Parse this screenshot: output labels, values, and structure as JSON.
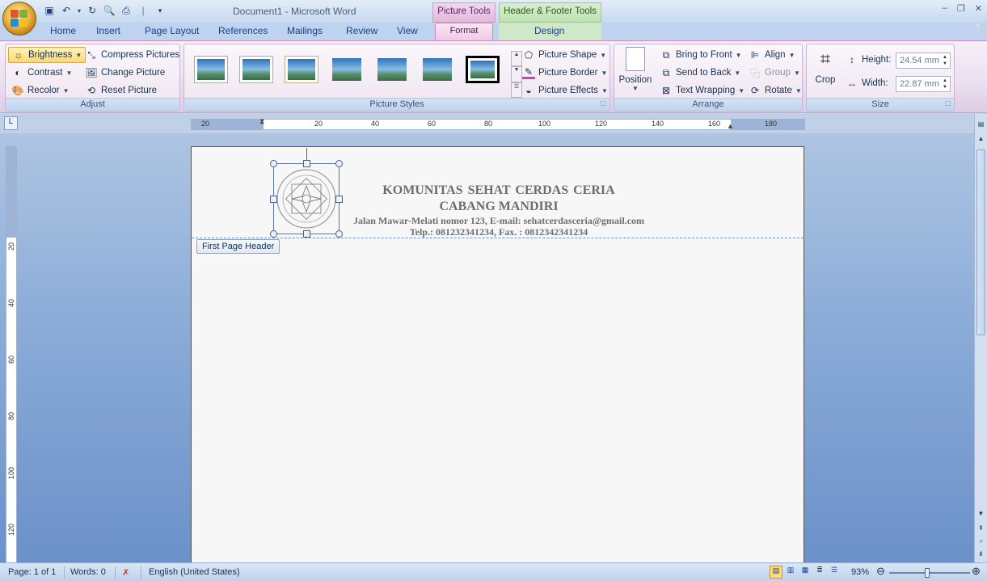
{
  "titlebar": {
    "doc_title": "Document1 - Microsoft Word",
    "context_picture_tools": "Picture Tools",
    "context_header_footer_tools": "Header & Footer Tools",
    "minimize": "–",
    "restore": "❐",
    "close": "✕"
  },
  "tabs": {
    "home": "Home",
    "insert": "Insert",
    "page_layout": "Page Layout",
    "references": "References",
    "mailings": "Mailings",
    "review": "Review",
    "view": "View",
    "format": "Format",
    "design": "Design"
  },
  "ribbon": {
    "adjust": {
      "brightness": "Brightness",
      "contrast": "Contrast",
      "recolor": "Recolor",
      "compress": "Compress Pictures",
      "change": "Change Picture",
      "reset": "Reset Picture",
      "label": "Adjust"
    },
    "styles": {
      "shape": "Picture Shape",
      "border": "Picture Border",
      "effects": "Picture Effects",
      "label": "Picture Styles"
    },
    "arrange": {
      "position": "Position",
      "bring_front": "Bring to Front",
      "send_back": "Send to Back",
      "text_wrap": "Text Wrapping",
      "align": "Align",
      "group": "Group",
      "rotate": "Rotate",
      "label": "Arrange"
    },
    "size": {
      "crop": "Crop",
      "height_label": "Height:",
      "height_value": "24.54 mm",
      "width_label": "Width:",
      "width_value": "22.87 mm",
      "label": "Size"
    }
  },
  "ruler": {
    "h_labels": [
      "20",
      "20",
      "40",
      "60",
      "80",
      "100",
      "120",
      "140",
      "160",
      "180"
    ],
    "v_labels": [
      "20",
      "40",
      "60",
      "80",
      "100",
      "120"
    ]
  },
  "document": {
    "line1": "KOMUNITAS  SEHAT  CERDAS  CERIA",
    "line2": "CABANG  MANDIRI",
    "line3": "Jalan Mawar-Melati  nomor 123, E-mail:  sehatcerdasceria@gmail.com",
    "line4": "Telp.: 081232341234,  Fax. : 0812342341234",
    "header_tag": "First Page Header"
  },
  "status": {
    "page": "Page: 1 of 1",
    "words": "Words: 0",
    "language": "English (United States)",
    "zoom": "93%"
  },
  "colors": {
    "accent": "#15428b",
    "format_tab": "#f0c8e4",
    "design_tab": "#cfe8c8"
  }
}
